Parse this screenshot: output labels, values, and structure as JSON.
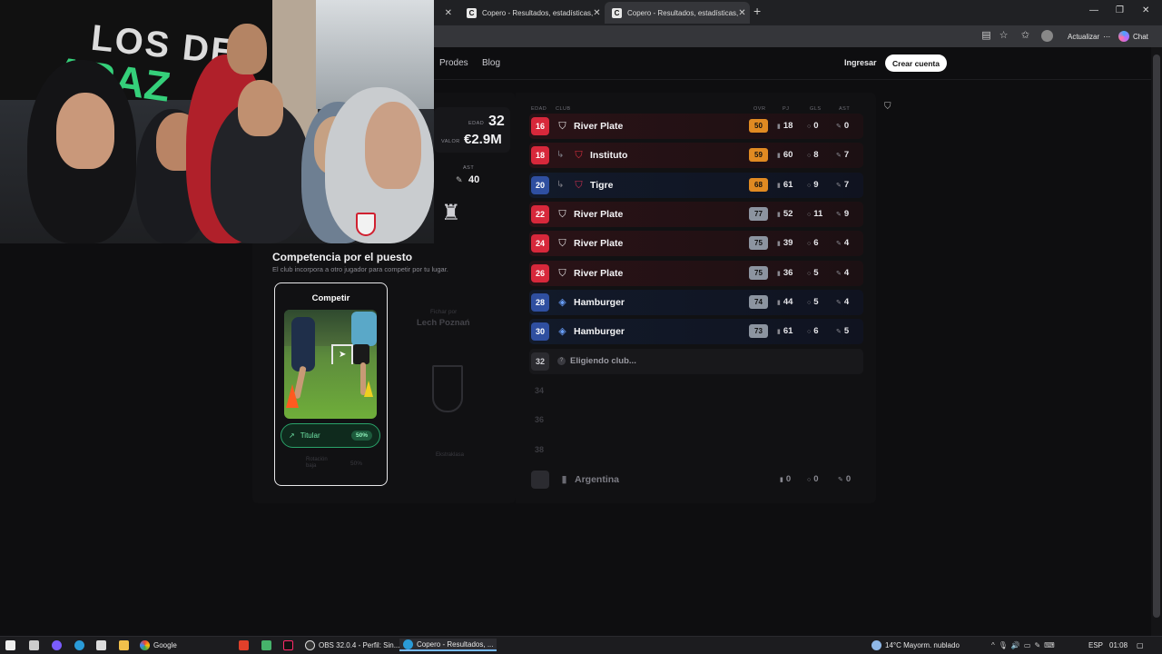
{
  "browser": {
    "tabs": [
      {
        "label": "",
        "active": false
      },
      {
        "label": "Copero - Resultados, estadísticas,",
        "active": false
      },
      {
        "label": "Copero - Resultados, estadísticas,",
        "active": true
      }
    ],
    "close_glyph": "✕",
    "new_tab_glyph": "+",
    "update_label": "Actualizar",
    "chat_label": "Chat",
    "window_controls": [
      "—",
      "❐",
      "✕"
    ]
  },
  "site": {
    "nav": [
      "Prodes",
      "Blog"
    ],
    "login": "Ingresar",
    "signup": "Crear cuenta"
  },
  "player": {
    "edad_label": "EDAD",
    "edad": "32",
    "valor_label": "VALOR",
    "valor": "€2.9M",
    "ast_label": "AST",
    "ast": "40"
  },
  "competencia": {
    "title": "Competencia por el puesto",
    "subtitle": "El club incorpora a otro jugador para competir por tu lugar.",
    "card_title": "Competir",
    "titular_label": "Titular",
    "titular_pct": "50%",
    "option2_label": "Rotación baja",
    "option2_pct": "50%",
    "fichar_label": "Fichar por",
    "fichar_club": "Lech Poznań",
    "fichar_note": "Ekstraklasa"
  },
  "table": {
    "headers": {
      "edad": "EDAD",
      "club": "CLUB",
      "ovr": "OVR",
      "pj": "PJ",
      "gls": "GLS",
      "ast": "AST"
    },
    "rows": [
      {
        "age": "16",
        "club": "River Plate",
        "loan": false,
        "ovr": "50",
        "pj": "18",
        "gls": "0",
        "ast": "0",
        "theme": "red",
        "ovr_color": "orange"
      },
      {
        "age": "18",
        "club": "Instituto",
        "loan": true,
        "ovr": "59",
        "pj": "60",
        "gls": "8",
        "ast": "7",
        "theme": "red",
        "ovr_color": "orange"
      },
      {
        "age": "20",
        "club": "Tigre",
        "loan": true,
        "ovr": "68",
        "pj": "61",
        "gls": "9",
        "ast": "7",
        "theme": "blue",
        "ovr_color": "orange"
      },
      {
        "age": "22",
        "club": "River Plate",
        "loan": false,
        "ovr": "77",
        "pj": "52",
        "gls": "11",
        "ast": "9",
        "theme": "red",
        "ovr_color": "grey"
      },
      {
        "age": "24",
        "club": "River Plate",
        "loan": false,
        "ovr": "75",
        "pj": "39",
        "gls": "6",
        "ast": "4",
        "theme": "red",
        "ovr_color": "grey"
      },
      {
        "age": "26",
        "club": "River Plate",
        "loan": false,
        "ovr": "75",
        "pj": "36",
        "gls": "5",
        "ast": "4",
        "theme": "red",
        "ovr_color": "grey"
      },
      {
        "age": "28",
        "club": "Hamburger",
        "loan": false,
        "ovr": "74",
        "pj": "44",
        "gls": "5",
        "ast": "4",
        "theme": "blue",
        "ovr_color": "grey"
      },
      {
        "age": "30",
        "club": "Hamburger",
        "loan": false,
        "ovr": "73",
        "pj": "61",
        "gls": "6",
        "ast": "5",
        "theme": "blue",
        "ovr_color": "grey"
      }
    ],
    "pending_age": "32",
    "pending_label": "Eligiendo club...",
    "future_ages": [
      "34",
      "36",
      "38"
    ],
    "national": {
      "name": "Argentina",
      "pj": "0",
      "gls": "0",
      "ast": "0"
    }
  },
  "taskbar": {
    "google": "Google",
    "obs": "OBS 32.0.4 - Perfil: Sin...",
    "copero": "Copero - Resultados, ...",
    "weather": "14°C  Mayorm. nublado",
    "lang": "ESP",
    "time": "01:08"
  },
  "colors": {
    "red_age": "#d7283b",
    "blue_age": "#2f4fa0",
    "ovr_orange": "#e08a22",
    "ovr_grey": "#8c94a0",
    "titular_green": "#2aa36a"
  }
}
